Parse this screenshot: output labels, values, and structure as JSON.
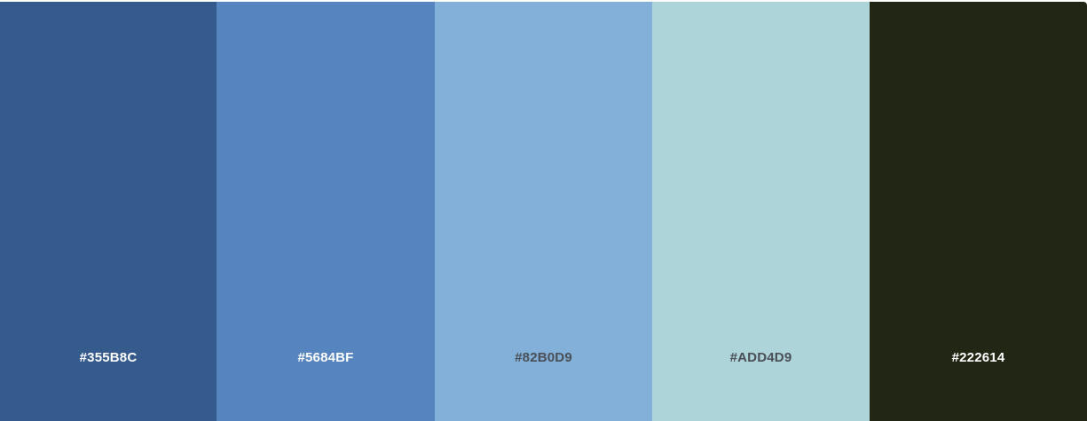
{
  "palette": {
    "swatches": [
      {
        "hex": "#355B8C",
        "label": "#355B8C",
        "label_color": "#ffffff"
      },
      {
        "hex": "#5684BF",
        "label": "#5684BF",
        "label_color": "#ffffff"
      },
      {
        "hex": "#82B0D9",
        "label": "#82B0D9",
        "label_color": "#4a4f55"
      },
      {
        "hex": "#ADD4D9",
        "label": "#ADD4D9",
        "label_color": "#4a4f55"
      },
      {
        "hex": "#222614",
        "label": "#222614",
        "label_color": "#ffffff"
      }
    ]
  }
}
